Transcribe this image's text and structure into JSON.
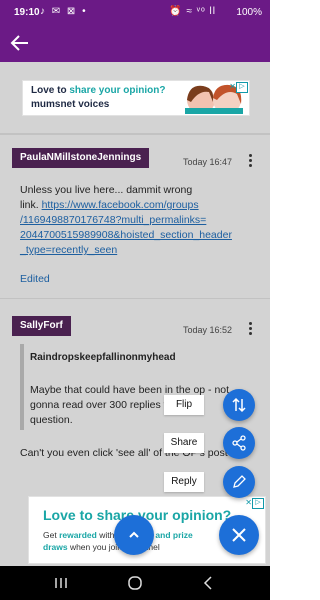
{
  "status": {
    "time": "19:10",
    "battery": "100%",
    "left_icons": "♪ ✉ ⊠ •",
    "right_icons": "⏰ ≈ ᵛᵒ ll"
  },
  "ad_top": {
    "line1_a": "Love to ",
    "line1_b": "share your opinion?",
    "line2": "mumsnet voices",
    "badge": "▷",
    "close": "✕"
  },
  "posts": [
    {
      "author": "PaulaNMillstoneJennings",
      "time": "Today 16:47",
      "text1": "Unless you live here... dammit wrong",
      "text2": "link. ",
      "link_lines": [
        "https://www.facebook.com/groups",
        "/1169498870176748?multi_permalinks=",
        "2044700515989908&hoisted_section_header",
        "_type=recently_seen"
      ],
      "edited": "Edited"
    },
    {
      "author": "SallyForf",
      "time": "Today 16:52",
      "quote_name": "Raindropskeepfallinonmyhead",
      "quote_text_lines": [
        "Maybe that could have been in the op - not",
        "gonna read over 300 replies for 1",
        "question."
      ],
      "text": "Can't you even click 'see all' of the OP's post?"
    }
  ],
  "fab": {
    "flip": "Flip",
    "share": "Share",
    "reply": "Reply"
  },
  "ad_bottom": {
    "title": "Love to share your opinion?",
    "line1_a": "Get ",
    "line1_b": "rewarded",
    "line1_c": " with ",
    "line1_d": "products and prize",
    "line2_a": "draws",
    "line2_b": " when you join our panel",
    "badge": "▷",
    "close": "✕"
  },
  "colors": {
    "brand": "#6b1a86",
    "author_bg": "#4a2150",
    "fab": "#1d6fd8",
    "link": "#1d5fa0"
  }
}
